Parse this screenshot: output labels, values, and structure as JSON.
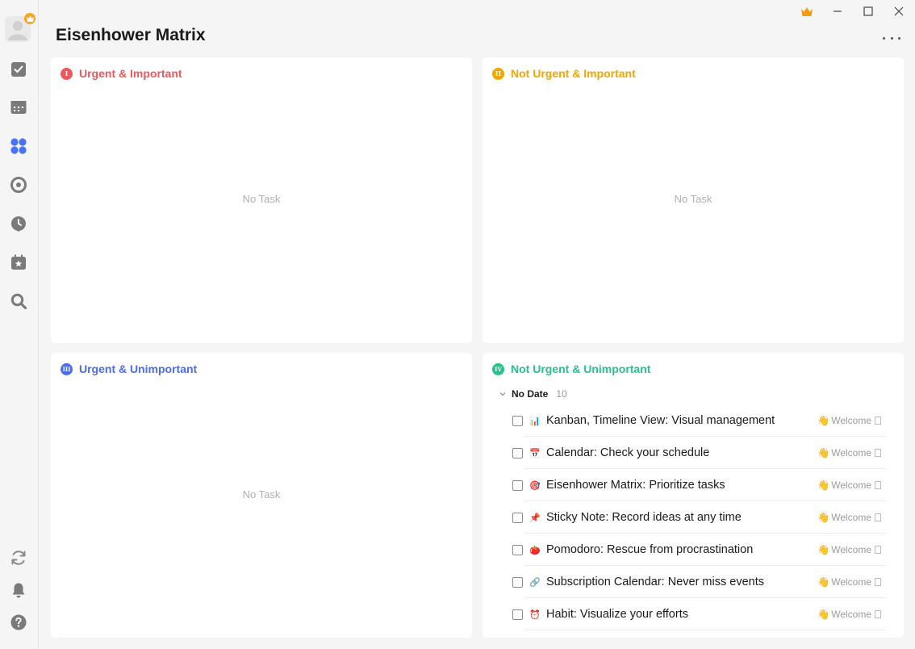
{
  "window": {
    "title": "Eisenhower Matrix",
    "more_icon": "more-dots-icon"
  },
  "sidebar": {
    "top_items": [
      {
        "name": "task-check-icon"
      },
      {
        "name": "calendar-icon"
      },
      {
        "name": "matrix-icon",
        "active": true
      },
      {
        "name": "pomodoro-icon"
      },
      {
        "name": "habit-icon"
      },
      {
        "name": "countdown-icon"
      },
      {
        "name": "search-icon"
      }
    ],
    "bottom_items": [
      {
        "name": "sync-icon"
      },
      {
        "name": "bell-icon"
      },
      {
        "name": "help-icon"
      }
    ]
  },
  "colors": {
    "q1": "#f0575c",
    "q2": "#f3a500",
    "q3": "#4a6cf0",
    "q4": "#27c28a",
    "active": "#4a72f5"
  },
  "quadrants": [
    {
      "numeral": "I",
      "title": "Urgent & Important",
      "empty_text": "No Task"
    },
    {
      "numeral": "II",
      "title": "Not Urgent & Important",
      "empty_text": "No Task"
    },
    {
      "numeral": "III",
      "title": "Urgent & Unimportant",
      "empty_text": "No Task"
    },
    {
      "numeral": "IV",
      "title": "Not Urgent & Unimportant",
      "group": {
        "title": "No Date",
        "count": "10"
      },
      "tasks": [
        {
          "emoji": "📊",
          "title": "Kanban, Timeline View: Visual management",
          "list": "Welcome"
        },
        {
          "emoji": "📅",
          "title": "Calendar: Check your schedule",
          "list": "Welcome"
        },
        {
          "emoji": "🎯",
          "title": "Eisenhower Matrix: Prioritize tasks",
          "list": "Welcome"
        },
        {
          "emoji": "📌",
          "title": "Sticky Note: Record ideas at any time",
          "list": "Welcome"
        },
        {
          "emoji": "🍅",
          "title": "Pomodoro: Rescue from procrastination",
          "list": "Welcome"
        },
        {
          "emoji": "🔗",
          "title": "Subscription Calendar: Never miss events",
          "list": "Welcome"
        },
        {
          "emoji": "⏰",
          "title": "Habit: Visualize your efforts",
          "list": "Welcome"
        }
      ]
    }
  ]
}
